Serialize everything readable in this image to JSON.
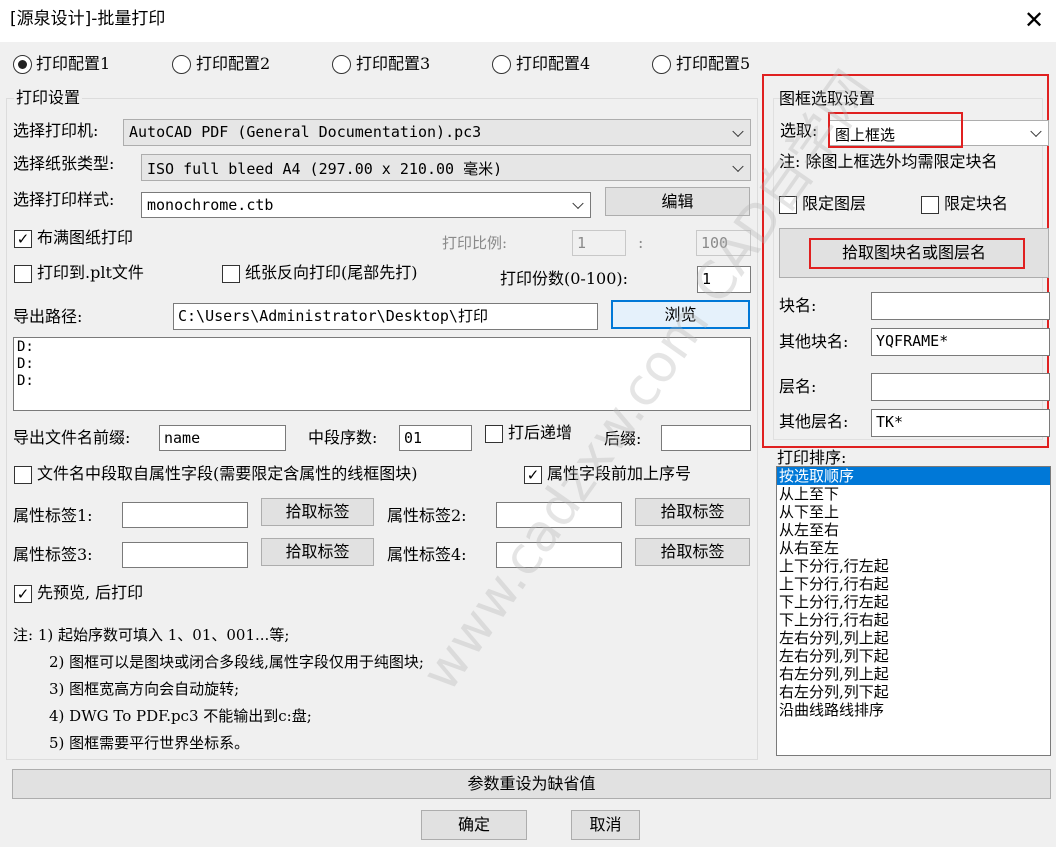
{
  "window": {
    "title": "[源泉设计]-批量打印",
    "close_label": "✕"
  },
  "configs": [
    {
      "label": "打印配置1",
      "selected": true
    },
    {
      "label": "打印配置2",
      "selected": false
    },
    {
      "label": "打印配置3",
      "selected": false
    },
    {
      "label": "打印配置4",
      "selected": false
    },
    {
      "label": "打印配置5",
      "selected": false
    }
  ],
  "print_settings": {
    "group_title": "打印设置",
    "printer_label": "选择打印机:",
    "printer_value": "AutoCAD PDF (General Documentation).pc3",
    "paper_label": "选择纸张类型:",
    "paper_value": "ISO full bleed A4 (297.00 x 210.00 毫米)",
    "style_label": "选择打印样式:",
    "style_value": "monochrome.ctb",
    "edit_button": "编辑",
    "fit_paper_label": "布满图纸打印",
    "fit_paper_checked": true,
    "scale_label": "打印比例:",
    "scale_value1": "1",
    "scale_sep": ":",
    "scale_value2": "100",
    "plt_label": "打印到.plt文件",
    "reverse_label": "纸张反向打印(尾部先打)",
    "copies_label": "打印份数(0-100):",
    "copies_value": "1",
    "export_path_label": "导出路径:",
    "export_path_value": "C:\\Users\\Administrator\\Desktop\\打印",
    "browse_button": "浏览",
    "path_lines": [
      "D:",
      "D:",
      "D:"
    ],
    "prefix_label": "导出文件名前缀:",
    "prefix_value": "name",
    "mid_seq_label": "中段序数:",
    "mid_seq_value": "01",
    "after_inc_label": "打后递增",
    "suffix_label": "后缀:",
    "suffix_value": "",
    "attr_mid_label": "文件名中段取自属性字段(需要限定含属性的线框图块)",
    "attr_prefix_label": "属性字段前加上序号",
    "attr_prefix_checked": true,
    "tag1_label": "属性标签1:",
    "tag2_label": "属性标签2:",
    "tag3_label": "属性标签3:",
    "tag4_label": "属性标签4:",
    "pick_tag_button": "拾取标签",
    "preview_label": "先预览, 后打印",
    "preview_checked": true
  },
  "notes": [
    "注: 1) 起始序数可填入 1、01、001...等;",
    "2) 图框可以是图块或闭合多段线,属性字段仅用于纯图块;",
    "3) 图框宽高方向会自动旋转;",
    "4) DWG To PDF.pc3 不能输出到c:盘;",
    "5) 图框需要平行世界坐标系。"
  ],
  "frame_settings": {
    "group_title": "图框选取设置",
    "select_label": "选取:",
    "select_value": "图上框选",
    "note": "注: 除图上框选外均需限定块名",
    "limit_layer_label": "限定图层",
    "limit_block_label": "限定块名",
    "pick_button": "拾取图块名或图层名",
    "block_name_label": "块名:",
    "block_name_value": "",
    "other_block_label": "其他块名:",
    "other_block_value": "YQFRAME*",
    "layer_name_label": "层名:",
    "layer_name_value": "",
    "other_layer_label": "其他层名:",
    "other_layer_value": "TK*"
  },
  "print_order": {
    "label": "打印排序:",
    "items": [
      "按选取顺序",
      "从上至下",
      "从下至上",
      "从左至右",
      "从右至左",
      "上下分行,行左起",
      "上下分行,行右起",
      "下上分行,行左起",
      "下上分行,行右起",
      "左右分列,列上起",
      "左右分列,列下起",
      "右左分列,列上起",
      "右左分列,列下起",
      "沿曲线路线排序"
    ],
    "selected_index": 0
  },
  "footer": {
    "reset_button": "参数重设为缺省值",
    "ok_button": "确定",
    "cancel_button": "取消"
  },
  "watermark": "www.cadzxw.com  CAD自学网",
  "colors": {
    "accent": "#0078d7",
    "highlight_red": "#e02020"
  }
}
